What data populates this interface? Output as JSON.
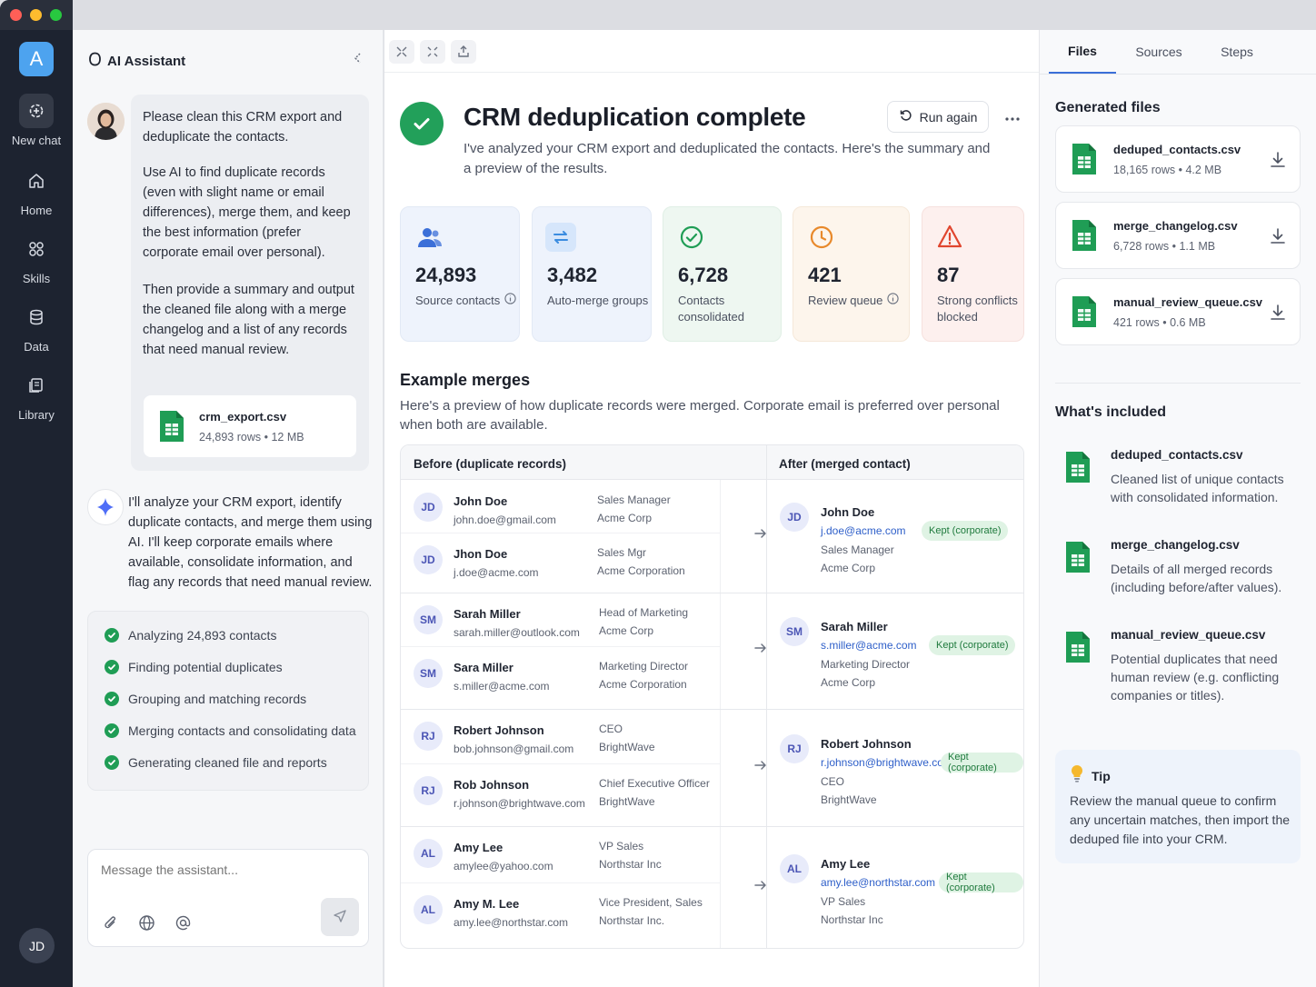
{
  "app": {
    "logo_letter": "A",
    "user_initials": "JD",
    "accent": "#4da3ef"
  },
  "rail": {
    "items": [
      {
        "label": "New chat",
        "icon": "new-chat-icon"
      },
      {
        "label": "Home",
        "icon": "home-icon"
      },
      {
        "label": "Skills",
        "icon": "skills-icon"
      },
      {
        "label": "Data",
        "icon": "database-icon"
      },
      {
        "label": "Library",
        "icon": "library-icon"
      }
    ]
  },
  "chat": {
    "title": "AI Assistant",
    "user_message": {
      "p1": "Please clean this CRM export and deduplicate the contacts.",
      "p2": "Use AI to find duplicate records (even with slight name or email differences), merge them, and keep the best information (prefer corporate email over personal).",
      "p3": "Then provide a summary and output the cleaned file along with a merge changelog and a list of any records that need manual review.",
      "attachment": {
        "name": "crm_export.csv",
        "rows": "24,893 rows",
        "size": "12 MB"
      }
    },
    "assistant_message": "I'll analyze your CRM export, identify duplicate contacts, and merge them using AI. I'll keep corporate emails where available, consolidate information, and flag any records that need manual review.",
    "steps": [
      "Analyzing 24,893 contacts",
      "Finding potential duplicates",
      "Grouping and matching records",
      "Merging contacts and consolidating data",
      "Generating cleaned file and reports"
    ],
    "input_placeholder": "Message the assistant..."
  },
  "main": {
    "title": "CRM deduplication complete",
    "subtitle": "I've analyzed your CRM export and deduplicated the contacts. Here's the summary and a preview of the results.",
    "run_again": "Run again",
    "stats": [
      {
        "value": "24,893",
        "label": "Source contacts",
        "bg": "#eef3fc",
        "color": "#3b6fd8"
      },
      {
        "value": "3,482",
        "label": "Auto-merge groups",
        "bg": "#eef3fc",
        "color": "#3b8ce0"
      },
      {
        "value": "6,728",
        "label": "Contacts consolidated",
        "bg": "#eef7f1",
        "color": "#1f9d55"
      },
      {
        "value": "421",
        "label": "Review queue",
        "bg": "#fdf5ec",
        "color": "#e8892b"
      },
      {
        "value": "87",
        "label": "Strong conflicts blocked",
        "bg": "#fdf0ee",
        "color": "#e0462f"
      }
    ],
    "examples_title": "Example merges",
    "examples_desc": "Here's a preview of how duplicate records were merged. Corporate email is preferred over personal when both are available.",
    "col_before": "Before (duplicate records)",
    "col_after": "After (merged contact)",
    "merges": [
      {
        "before": [
          {
            "initials": "JD",
            "name": "John Doe",
            "email": "john.doe@gmail.com",
            "role": "Sales Manager",
            "company": "Acme Corp"
          },
          {
            "initials": "JD",
            "name": "Jhon Doe",
            "email": "j.doe@acme.com",
            "role": "Sales Mgr",
            "company": "Acme Corporation"
          }
        ],
        "after": {
          "initials": "JD",
          "name": "John Doe",
          "email": "j.doe@acme.com",
          "badge": "Kept (corporate)",
          "role": "Sales Manager",
          "company": "Acme Corp"
        }
      },
      {
        "before": [
          {
            "initials": "SM",
            "name": "Sarah Miller",
            "email": "sarah.miller@outlook.com",
            "role": "Head of Marketing",
            "company": "Acme Corp"
          },
          {
            "initials": "SM",
            "name": "Sara Miller",
            "email": "s.miller@acme.com",
            "role": "Marketing Director",
            "company": "Acme Corporation"
          }
        ],
        "after": {
          "initials": "SM",
          "name": "Sarah Miller",
          "email": "s.miller@acme.com",
          "badge": "Kept (corporate)",
          "role": "Marketing Director",
          "company": "Acme Corp"
        }
      },
      {
        "before": [
          {
            "initials": "RJ",
            "name": "Robert Johnson",
            "email": "bob.johnson@gmail.com",
            "role": "CEO",
            "company": "BrightWave"
          },
          {
            "initials": "RJ",
            "name": "Rob Johnson",
            "email": "r.johnson@brightwave.com",
            "role": "Chief Executive Officer",
            "company": "BrightWave"
          }
        ],
        "after": {
          "initials": "RJ",
          "name": "Robert Johnson",
          "email": "r.johnson@brightwave.com",
          "badge": "Kept (corporate)",
          "role": "CEO",
          "company": "BrightWave"
        }
      },
      {
        "before": [
          {
            "initials": "AL",
            "name": "Amy Lee",
            "email": "amylee@yahoo.com",
            "role": "VP Sales",
            "company": "Northstar Inc"
          },
          {
            "initials": "AL",
            "name": "Amy M. Lee",
            "email": "amy.lee@northstar.com",
            "role": "Vice President, Sales",
            "company": "Northstar Inc."
          }
        ],
        "after": {
          "initials": "AL",
          "name": "Amy Lee",
          "email": "amy.lee@northstar.com",
          "badge": "Kept (corporate)",
          "role": "VP Sales",
          "company": "Northstar Inc"
        }
      }
    ]
  },
  "right": {
    "tabs": [
      "Files",
      "Sources",
      "Steps"
    ],
    "generated_title": "Generated files",
    "files": [
      {
        "name": "deduped_contacts.csv",
        "rows": "18,165 rows",
        "size": "4.2 MB"
      },
      {
        "name": "merge_changelog.csv",
        "rows": "6,728 rows",
        "size": "1.1 MB"
      },
      {
        "name": "manual_review_queue.csv",
        "rows": "421 rows",
        "size": "0.6 MB"
      }
    ],
    "included_title": "What's included",
    "included": [
      {
        "name": "deduped_contacts.csv",
        "desc": "Cleaned list of unique contacts with consolidated information."
      },
      {
        "name": "merge_changelog.csv",
        "desc": "Details of all merged records (including before/after values)."
      },
      {
        "name": "manual_review_queue.csv",
        "desc": "Potential duplicates that need human review (e.g. conflicting companies or titles)."
      }
    ],
    "tip_title": "Tip",
    "tip_text": "Review the manual queue to confirm any uncertain matches, then import the deduped file into your CRM."
  }
}
